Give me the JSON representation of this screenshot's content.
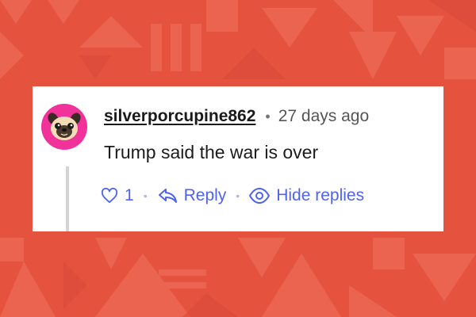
{
  "comment": {
    "username": "silverporcupine862",
    "separator": "•",
    "timestamp": "27 days ago",
    "text": "Trump said the war is over",
    "like_count": "1",
    "reply_label": "Reply",
    "hide_replies_label": "Hide replies",
    "action_separator": "•",
    "avatar": "pug-face-avatar"
  },
  "colors": {
    "background": "#e5533f",
    "accent": "#4f63f0",
    "avatar_bg": "#f0329a"
  },
  "icons": {
    "like": "heart-icon",
    "reply": "reply-arrow-icon",
    "hide": "eye-icon"
  }
}
